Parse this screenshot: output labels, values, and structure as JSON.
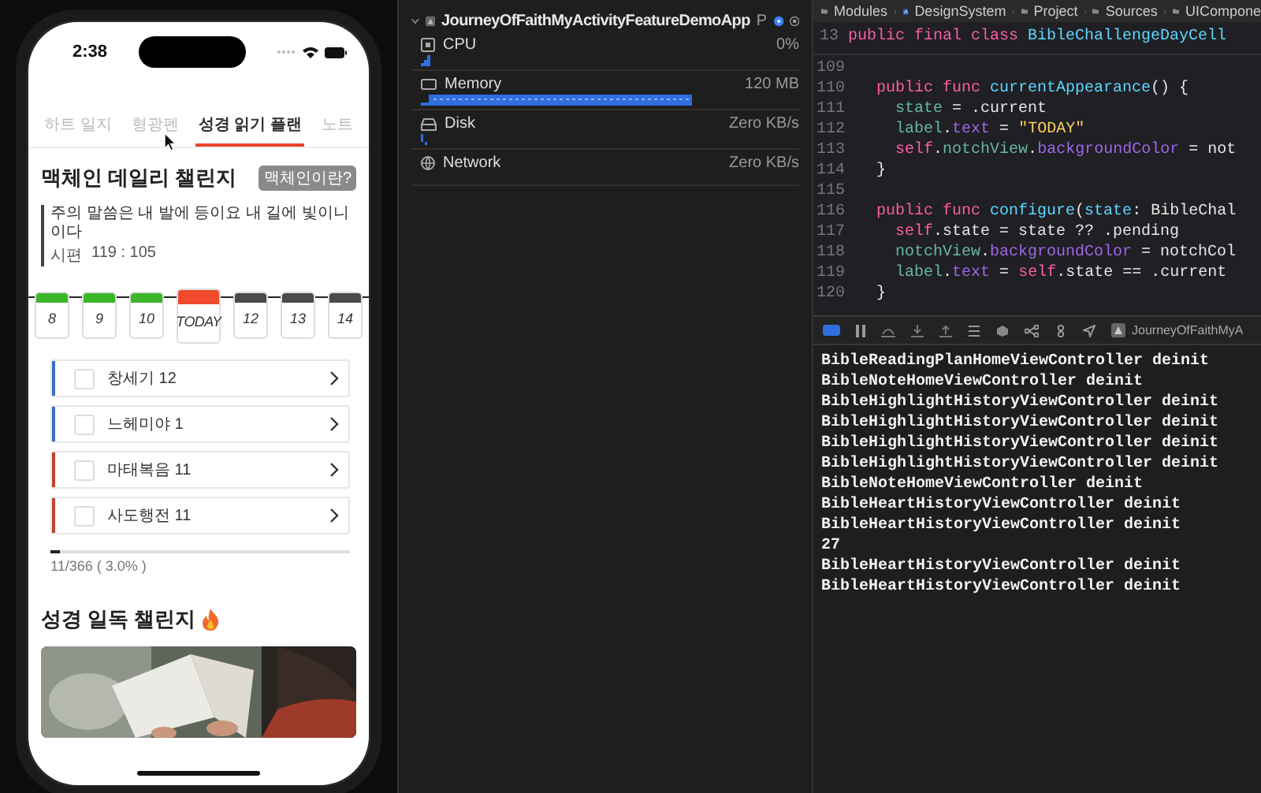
{
  "phone": {
    "status_bar": {
      "time": "2:38"
    },
    "tabs": [
      {
        "label": "하트 일지",
        "selected": false
      },
      {
        "label": "형광펜",
        "selected": false
      },
      {
        "label": "성경 읽기 플랜",
        "selected": true
      },
      {
        "label": "노트",
        "selected": false
      }
    ],
    "daily_challenge": {
      "title": "맥체인 데일리 챌린지",
      "badge": "맥체인이란?",
      "verse": "주의 말씀은 내 발에 등이요 내 길에 빛이니이다",
      "reference_book": "시편",
      "reference": "119 : 105",
      "days": [
        {
          "label": "8",
          "kind": "done"
        },
        {
          "label": "9",
          "kind": "done"
        },
        {
          "label": "10",
          "kind": "done"
        },
        {
          "label": "TODAY",
          "kind": "today"
        },
        {
          "label": "12",
          "kind": "pending"
        },
        {
          "label": "13",
          "kind": "pending"
        },
        {
          "label": "14",
          "kind": "pending"
        }
      ],
      "readings": [
        {
          "label": "창세기 12",
          "checked": false,
          "color": "#3a6fc4"
        },
        {
          "label": "느헤미야 1",
          "checked": false,
          "color": "#3a6fc4"
        },
        {
          "label": "마태복음 11",
          "checked": false,
          "color": "#c0432e"
        },
        {
          "label": "사도행전 11",
          "checked": false,
          "color": "#c0432e"
        }
      ],
      "progress": {
        "level": 0.03,
        "text": "11/366 ( 3.0% )"
      }
    },
    "reading_challenge": {
      "title": "성경 일독 챌린지"
    }
  },
  "debug_navigator": {
    "app": "JourneyOfFaithMyActivityFeatureDemoApp",
    "app_suffix": "P",
    "gauges": [
      {
        "name": "CPU",
        "value": "0%",
        "kind": "sparkline"
      },
      {
        "name": "Memory",
        "value": "120 MB",
        "kind": "bar"
      },
      {
        "name": "Disk",
        "value": "Zero KB/s",
        "kind": "tick"
      },
      {
        "name": "Network",
        "value": "Zero KB/s",
        "kind": "none"
      }
    ]
  },
  "editor": {
    "breadcrumb": [
      "Modules",
      "DesignSystem",
      "Project",
      "Sources",
      "UICompone"
    ],
    "sticky_line": {
      "number": "13",
      "tokens": [
        {
          "text": "public final class ",
          "kind": "kw"
        },
        {
          "text": "BibleChallengeDayCell",
          "kind": "decl"
        }
      ]
    },
    "lines": [
      {
        "number": "109"
      },
      {
        "number": "110",
        "tokens": [
          {
            "text": "  public func ",
            "kind": "kw"
          },
          {
            "text": "currentAppearance",
            "kind": "decl"
          },
          {
            "text": "() {",
            "kind": "plain"
          }
        ]
      },
      {
        "number": "111",
        "tokens": [
          {
            "text": "    state",
            "kind": "prop"
          },
          {
            "text": " = .current",
            "kind": "plain"
          }
        ]
      },
      {
        "number": "112",
        "tokens": [
          {
            "text": "    label",
            "kind": "prop"
          },
          {
            "text": ".",
            "kind": "plain"
          },
          {
            "text": "text",
            "kind": "sys"
          },
          {
            "text": " = ",
            "kind": "plain"
          },
          {
            "text": "\"TODAY\"",
            "kind": "str"
          }
        ]
      },
      {
        "number": "113",
        "tokens": [
          {
            "text": "    self",
            "kind": "kw"
          },
          {
            "text": ".",
            "kind": "plain"
          },
          {
            "text": "notchView",
            "kind": "prop"
          },
          {
            "text": ".",
            "kind": "plain"
          },
          {
            "text": "backgroundColor",
            "kind": "sys"
          },
          {
            "text": " = not",
            "kind": "plain"
          }
        ]
      },
      {
        "number": "114",
        "tokens": [
          {
            "text": "  }",
            "kind": "plain"
          }
        ]
      },
      {
        "number": "115"
      },
      {
        "number": "116",
        "tokens": [
          {
            "text": "  public func ",
            "kind": "kw"
          },
          {
            "text": "configure",
            "kind": "decl"
          },
          {
            "text": "(",
            "kind": "plain"
          },
          {
            "text": "state",
            "kind": "decl"
          },
          {
            "text": ": BibleChal",
            "kind": "plain"
          }
        ]
      },
      {
        "number": "117",
        "tokens": [
          {
            "text": "    self",
            "kind": "kw"
          },
          {
            "text": ".state = state ?? .pending",
            "kind": "plain"
          }
        ]
      },
      {
        "number": "118",
        "tokens": [
          {
            "text": "    notchView",
            "kind": "prop"
          },
          {
            "text": ".",
            "kind": "plain"
          },
          {
            "text": "backgroundColor",
            "kind": "sys"
          },
          {
            "text": " = notchCol",
            "kind": "plain"
          }
        ]
      },
      {
        "number": "119",
        "tokens": [
          {
            "text": "    label",
            "kind": "prop"
          },
          {
            "text": ".",
            "kind": "plain"
          },
          {
            "text": "text",
            "kind": "sys"
          },
          {
            "text": " = ",
            "kind": "plain"
          },
          {
            "text": "self",
            "kind": "kw"
          },
          {
            "text": ".state == .current",
            "kind": "plain"
          }
        ]
      },
      {
        "number": "120",
        "tokens": [
          {
            "text": "  }",
            "kind": "plain"
          }
        ]
      }
    ]
  },
  "console": {
    "scheme": "JourneyOfFaithMyA",
    "output": [
      "BibleReadingPlanHomeViewController deinit",
      "BibleNoteHomeViewController deinit",
      "BibleHighlightHistoryViewController deinit",
      "BibleHighlightHistoryViewController deinit",
      "BibleHighlightHistoryViewController deinit",
      "BibleHighlightHistoryViewController deinit",
      "BibleNoteHomeViewController deinit",
      "BibleHeartHistoryViewController deinit",
      "BibleHeartHistoryViewController deinit",
      "27",
      "BibleHeartHistoryViewController deinit",
      "BibleHeartHistoryViewController deinit"
    ]
  }
}
